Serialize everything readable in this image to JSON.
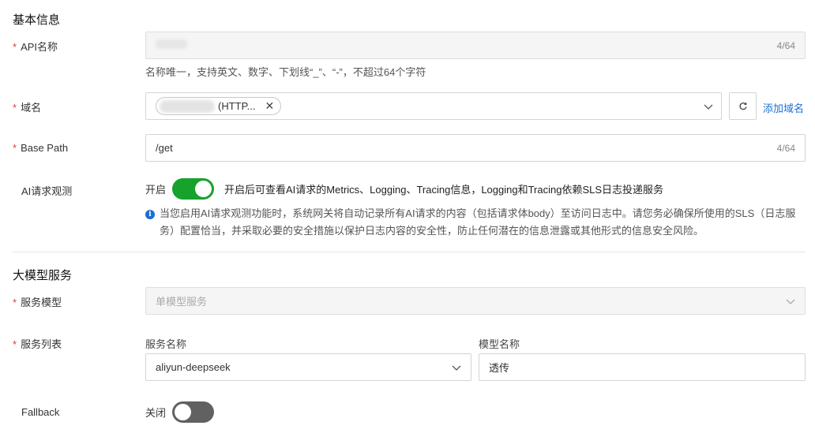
{
  "basic_info": {
    "section_title": "基本信息",
    "required_mark": "*",
    "api_name": {
      "label": "API名称",
      "count": "4/64",
      "help": "名称唯一，支持英文、数字、下划线“_”、“-”，不超过64个字符"
    },
    "domain": {
      "label": "域名",
      "tag_suffix": "(HTTP...",
      "add_link": "添加域名"
    },
    "base_path": {
      "label": "Base Path",
      "value": "/get",
      "count": "4/64"
    },
    "ai_observe": {
      "label": "AI请求观测",
      "switch_state": "开启",
      "enabled": true,
      "description": "开启后可查看AI请求的Metrics、Logging、Tracing信息，Logging和Tracing依赖SLS日志投递服务",
      "notice": "当您启用AI请求观测功能时，系统网关将自动记录所有AI请求的内容（包括请求体body）至访问日志中。请您务必确保所使用的SLS（日志服务）配置恰当，并采取必要的安全措施以保护日志内容的安全性，防止任何潜在的信息泄露或其他形式的信息安全风险。"
    }
  },
  "model_service": {
    "section_title": "大模型服务",
    "service_model": {
      "label": "服务模型",
      "placeholder": "单模型服务"
    },
    "service_list": {
      "label": "服务列表",
      "service_name_label": "服务名称",
      "service_name_value": "aliyun-deepseek",
      "model_name_label": "模型名称",
      "model_name_value": "透传"
    },
    "fallback": {
      "label": "Fallback",
      "switch_state": "关闭",
      "enabled": false
    }
  },
  "colors": {
    "switch_on": "#16a22b",
    "switch_off": "#616161",
    "link": "#1a6fd6",
    "required": "#e4393c"
  }
}
